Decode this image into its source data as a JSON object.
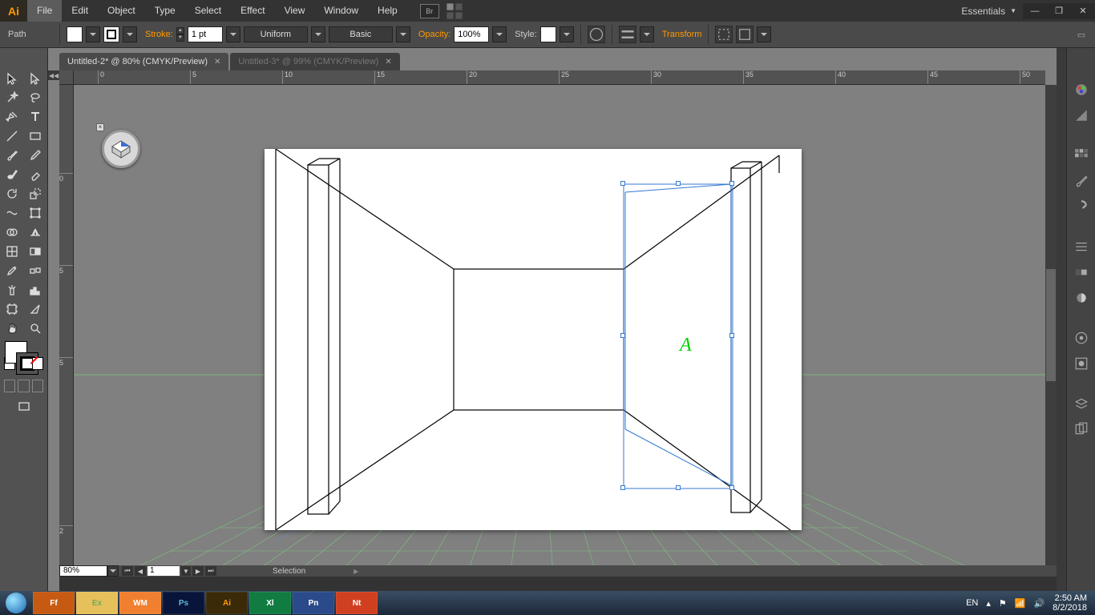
{
  "app": {
    "logo": "Ai"
  },
  "menu": {
    "items": [
      "File",
      "Edit",
      "Object",
      "Type",
      "Select",
      "Effect",
      "View",
      "Window",
      "Help"
    ],
    "active_index": 0,
    "bridge": "Br"
  },
  "workspace": {
    "label": "Essentials"
  },
  "ctrl": {
    "objtype": "Path",
    "stroke_label": "Stroke:",
    "stroke_weight": "1 pt",
    "brush_label": "Uniform",
    "style_group_label": "Basic",
    "opacity_label": "Opacity:",
    "opacity_value": "100%",
    "style_label": "Style:",
    "transform_label": "Transform"
  },
  "tabs": [
    {
      "label": "Untitled-2* @ 80% (CMYK/Preview)",
      "active": true
    },
    {
      "label": "Untitled-3* @ 99% (CMYK/Preview)",
      "active": false
    }
  ],
  "ruler": {
    "h": [
      "0",
      "5",
      "10",
      "15",
      "20",
      "25",
      "30",
      "35",
      "40",
      "45",
      "50"
    ],
    "v": [
      "0",
      "5",
      "5",
      "2"
    ]
  },
  "status": {
    "zoom": "80%",
    "page": "1",
    "mode": "Selection"
  },
  "canvas": {
    "letter": "A"
  },
  "taskbar": {
    "apps": [
      "Ff",
      "Ex",
      "WM",
      "Ps",
      "Ai",
      "Xl",
      "Pn",
      "Nt"
    ],
    "active_index": 4,
    "lang": "EN",
    "time": "2:50 AM",
    "date": "8/2/2018"
  }
}
